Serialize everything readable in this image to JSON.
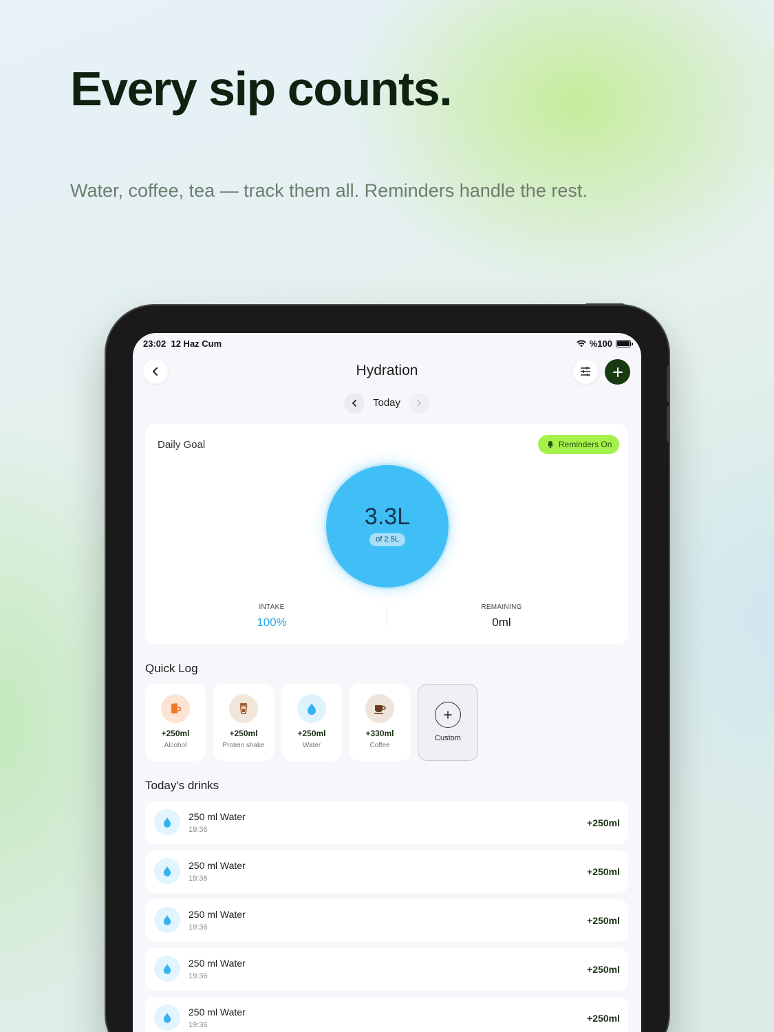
{
  "hero": {
    "title": "Every sip counts.",
    "subtitle": "Water, coffee, tea — track them all. Reminders handle the rest."
  },
  "status_bar": {
    "time": "23:02",
    "date": "12 Haz Cum",
    "battery": "%100"
  },
  "nav": {
    "title": "Hydration",
    "back_icon": "chevron-left-icon",
    "filter_icon": "sliders-icon",
    "add_icon": "plus-icon"
  },
  "date_nav": {
    "label": "Today"
  },
  "goal": {
    "title": "Daily Goal",
    "reminders_label": "Reminders On",
    "value": "3.3L",
    "target": "of 2.5L",
    "intake_label": "INTAKE",
    "intake_value": "100%",
    "remaining_label": "REMAINING",
    "remaining_value": "0ml"
  },
  "quick_log": {
    "title": "Quick Log",
    "items": [
      {
        "amount": "+250ml",
        "name": "Alcohol",
        "icon": "beer-mug-icon"
      },
      {
        "amount": "+250ml",
        "name": "Protein shake",
        "icon": "shaker-icon"
      },
      {
        "amount": "+250ml",
        "name": "Water",
        "icon": "water-drop-icon"
      },
      {
        "amount": "+330ml",
        "name": "Coffee",
        "icon": "coffee-cup-icon"
      }
    ],
    "custom_label": "Custom"
  },
  "todays_drinks": {
    "title": "Today's drinks",
    "items": [
      {
        "title": "250 ml Water",
        "time": "19:36",
        "amount": "+250ml"
      },
      {
        "title": "250 ml Water",
        "time": "19:36",
        "amount": "+250ml"
      },
      {
        "title": "250 ml Water",
        "time": "19:36",
        "amount": "+250ml"
      },
      {
        "title": "250 ml Water",
        "time": "19:36",
        "amount": "+250ml"
      },
      {
        "title": "250 ml Water",
        "time": "19:36",
        "amount": "+250ml"
      }
    ]
  },
  "colors": {
    "accent_dark": "#173a12",
    "water_blue": "#3fbff5",
    "reminder_green": "#a5f14b"
  }
}
